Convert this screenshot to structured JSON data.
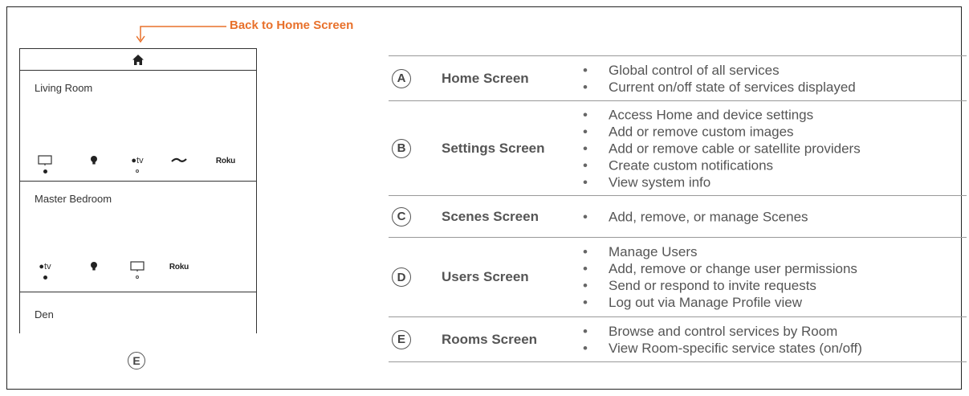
{
  "annotation": {
    "back_label": "Back to Home Screen",
    "accent_color": "#e8702a"
  },
  "phone": {
    "home_icon": "home-icon",
    "rooms": [
      {
        "name": "Living Room",
        "services": [
          {
            "icon": "tv-icon",
            "state": "on"
          },
          {
            "icon": "lightbulb-icon",
            "state": "none"
          },
          {
            "icon": "apple-tv-icon",
            "label": "tv",
            "state": "off"
          },
          {
            "icon": "bluray-icon",
            "state": "none"
          },
          {
            "icon": "roku-icon",
            "label": "Roku",
            "state": "none"
          }
        ]
      },
      {
        "name": "Master Bedroom",
        "services": [
          {
            "icon": "apple-tv-icon",
            "label": "tv",
            "state": "on"
          },
          {
            "icon": "lightbulb-icon",
            "state": "none"
          },
          {
            "icon": "tv-icon",
            "state": "off"
          },
          {
            "icon": "roku-icon",
            "label": "Roku",
            "state": "none"
          }
        ]
      },
      {
        "name": "Den",
        "services": []
      }
    ],
    "marker": "E"
  },
  "screens": [
    {
      "letter": "A",
      "name": "Home Screen",
      "items": [
        "Global control of all services",
        "Current on/off state of services displayed"
      ]
    },
    {
      "letter": "B",
      "name": "Settings Screen",
      "items": [
        "Access Home and device settings",
        "Add or remove custom images",
        "Add or remove cable or satellite providers",
        "Create custom notifications",
        "View system info"
      ]
    },
    {
      "letter": "C",
      "name": "Scenes Screen",
      "items": [
        "Add, remove, or manage Scenes"
      ]
    },
    {
      "letter": "D",
      "name": "Users Screen",
      "items": [
        "Manage Users",
        "Add, remove or change user permissions",
        "Send or respond to invite requests",
        "Log out via Manage Profile view"
      ]
    },
    {
      "letter": "E",
      "name": "Rooms Screen",
      "items": [
        "Browse and control services by Room",
        "View Room-specific service states (on/off)"
      ]
    }
  ]
}
